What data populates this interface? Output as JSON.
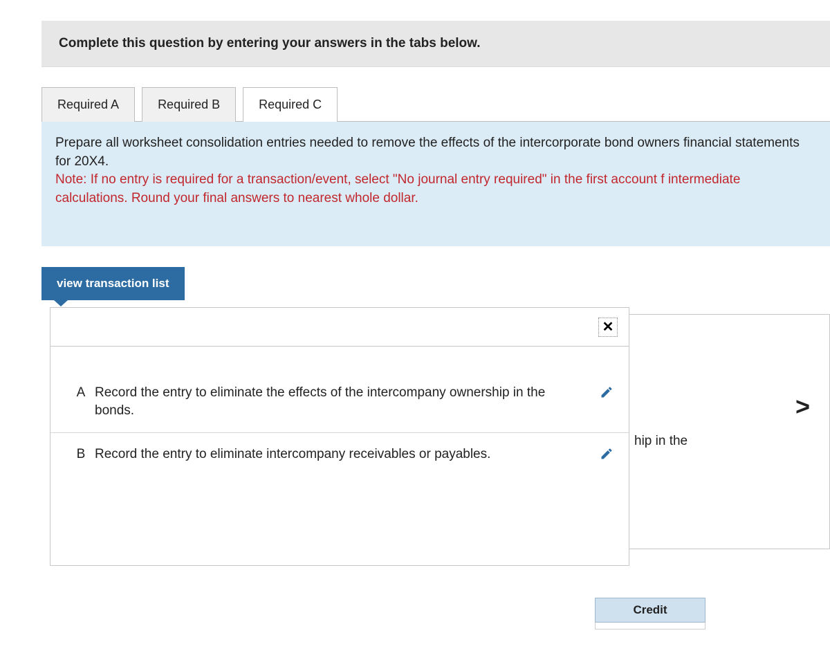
{
  "header": {
    "instruction": "Complete this question by entering your answers in the tabs below."
  },
  "tabs": [
    {
      "label": "Required A",
      "active": false
    },
    {
      "label": "Required B",
      "active": false
    },
    {
      "label": "Required C",
      "active": true
    }
  ],
  "prompt": {
    "main_1": "Prepare all worksheet consolidation entries needed to remove the effects of the intercorporate bond owners",
    "main_2": "financial statements for 20X4.",
    "note_1": "Note: If no entry is required for a transaction/event, select \"No journal entry required\" in the first account f",
    "note_2": "intermediate calculations. Round your final answers to nearest whole dollar."
  },
  "view_btn": "view transaction list",
  "popup": {
    "rows": [
      {
        "label": "A",
        "text": "Record the entry to eliminate the effects of the intercompany ownership in the bonds."
      },
      {
        "label": "B",
        "text": "Record the entry to eliminate intercompany receivables or payables."
      }
    ]
  },
  "bg_card": {
    "fragment": "hip in the",
    "next": ">"
  },
  "credit": {
    "header": "Credit"
  }
}
